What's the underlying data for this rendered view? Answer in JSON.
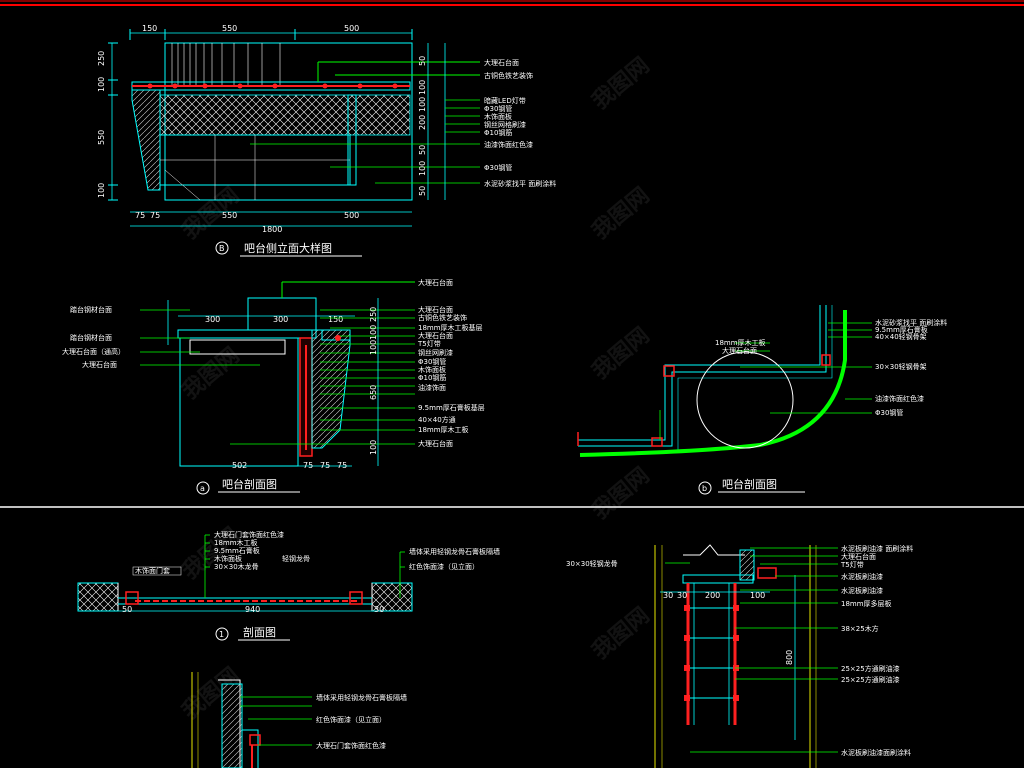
{
  "colors": {
    "background": "#000000",
    "frame_red": "#ff0000",
    "outline_cyan": "#00ffff",
    "leader_green": "#00ff00",
    "wall_yellow": "#e6e600",
    "text_white": "#ffffff",
    "member_red": "#ff2020"
  },
  "watermark": "我图网",
  "view_B": {
    "title": "吧台侧立面大样图",
    "marker": "B",
    "top_dims": [
      "150",
      "550",
      "500"
    ],
    "bottom_dims": [
      "75",
      "75",
      "550",
      "500"
    ],
    "total_dim": "1800",
    "left_dims": [
      "250",
      "100",
      "550",
      "100"
    ],
    "right_dims": [
      "50",
      "100",
      "100",
      "200",
      "50",
      "100",
      "50"
    ],
    "labels": [
      "大理石台面",
      "古铜色铁艺装饰",
      "暗藏LED灯带",
      "Φ30钢管",
      "木饰面板",
      "钢丝网格刷漆",
      "Φ10钢筋",
      "油漆饰面红色漆",
      "Φ30钢管",
      "水泥砂浆找平 面刷涂料"
    ]
  },
  "view_a": {
    "title": "吧台剖面图",
    "marker": "a",
    "left_labels": [
      "踏台钢材台面",
      "踏台钢材台面",
      "大理石台面（通高）",
      "大理石台面"
    ],
    "top_dims": [
      "300",
      "300",
      "150"
    ],
    "right_labels": [
      "大理石台面",
      "大理石台面",
      "古铜色铁艺装饰",
      "18mm厚木工板基层",
      "大理石台面",
      "T5灯带",
      "钢丝网刷漆",
      "Φ30钢管",
      "木饰面板",
      "Φ10钢筋",
      "油漆饰面",
      "9.5mm厚石膏板基层",
      "40×40方通",
      "18mm厚木工板",
      "大理石台面"
    ],
    "bottom_dims": [
      "502",
      "75",
      "75",
      "75"
    ],
    "side_dims": [
      "250",
      "100",
      "100",
      "650",
      "100"
    ]
  },
  "view_b": {
    "title": "吧台剖面图",
    "marker": "b",
    "left_labels": [
      "18mm厚木工板",
      "大理石台面"
    ],
    "right_labels": [
      "水泥砂浆找平 面刷涂料",
      "9.5mm厚石膏板",
      "40×40轻钢骨架",
      "30×30轻钢骨架",
      "油漆饰面红色漆",
      "Φ30钢管"
    ]
  },
  "view_1": {
    "title": "剖面图",
    "marker": "1",
    "labels": [
      "大理石门套饰面红色漆",
      "18mm木工板",
      "9.5mm石膏板",
      "木饰面板",
      "轻钢龙骨",
      "30×30木龙骨",
      "墙体采用轻钢龙骨石膏板隔墙",
      "红色饰面漆（见立面）"
    ],
    "dims": [
      "50",
      "940",
      "30"
    ],
    "tag": "木饰面门套"
  },
  "view_ladder": {
    "labels": [
      "水泥板刷油漆 面刷涂料",
      "大理石台面",
      "T5灯带",
      "水泥板刷油漆",
      "水泥板刷油漆",
      "18mm厚多层板",
      "38×25木方",
      "25×25方通刷油漆",
      "25×25方通刷油漆",
      "水泥板刷油漆面刷涂料"
    ],
    "left_label": "30×30轻钢龙骨",
    "dims": [
      "30",
      "30",
      "200",
      "100"
    ],
    "height_dim": "800"
  },
  "view_bottom": {
    "labels": [
      "墙体采用轻钢龙骨石膏板隔墙",
      "红色饰面漆（见立面）",
      "大理石门套饰面红色漆"
    ]
  }
}
